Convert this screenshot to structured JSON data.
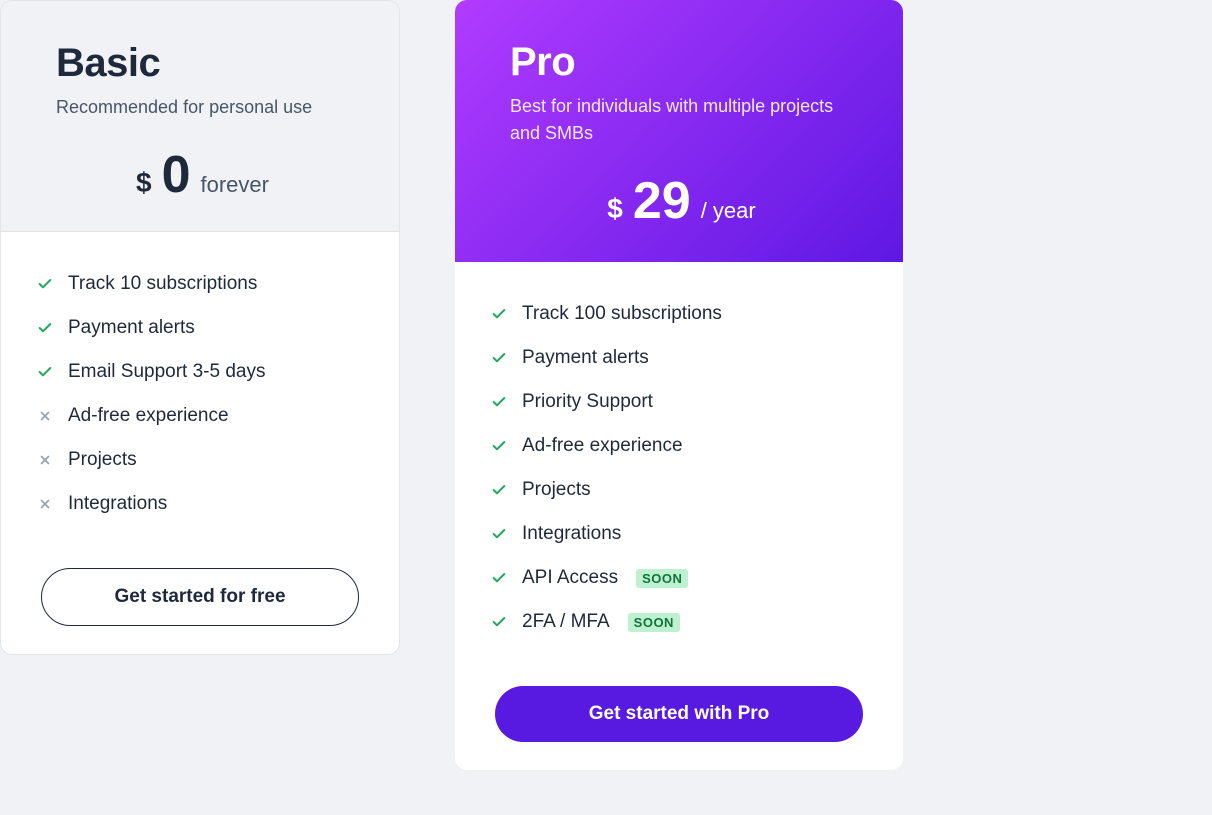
{
  "basic": {
    "name": "Basic",
    "subtitle": "Recommended for personal use",
    "currency": "$",
    "price": "0",
    "period": "forever",
    "features": [
      {
        "ok": true,
        "label": "Track 10 subscriptions"
      },
      {
        "ok": true,
        "label": "Payment alerts"
      },
      {
        "ok": true,
        "label": "Email Support 3-5 days"
      },
      {
        "ok": false,
        "label": "Ad-free experience"
      },
      {
        "ok": false,
        "label": "Projects"
      },
      {
        "ok": false,
        "label": "Integrations"
      }
    ],
    "cta": "Get started for free"
  },
  "pro": {
    "name": "Pro",
    "subtitle": "Best for individuals with multiple projects and SMBs",
    "currency": "$",
    "price": "29",
    "period": "/ year",
    "features": [
      {
        "ok": true,
        "label": "Track 100 subscriptions"
      },
      {
        "ok": true,
        "label": "Payment alerts"
      },
      {
        "ok": true,
        "label": "Priority Support"
      },
      {
        "ok": true,
        "label": "Ad-free experience"
      },
      {
        "ok": true,
        "label": "Projects"
      },
      {
        "ok": true,
        "label": "Integrations"
      },
      {
        "ok": true,
        "label": "API Access",
        "badge": "SOON"
      },
      {
        "ok": true,
        "label": "2FA / MFA",
        "badge": "SOON"
      }
    ],
    "cta": "Get started with Pro"
  },
  "colors": {
    "check": "#22a95c",
    "cross": "#94a3b8",
    "pro_gradient_from": "#b13bff",
    "pro_gradient_to": "#5e18e3",
    "pro_button": "#5819e0"
  }
}
